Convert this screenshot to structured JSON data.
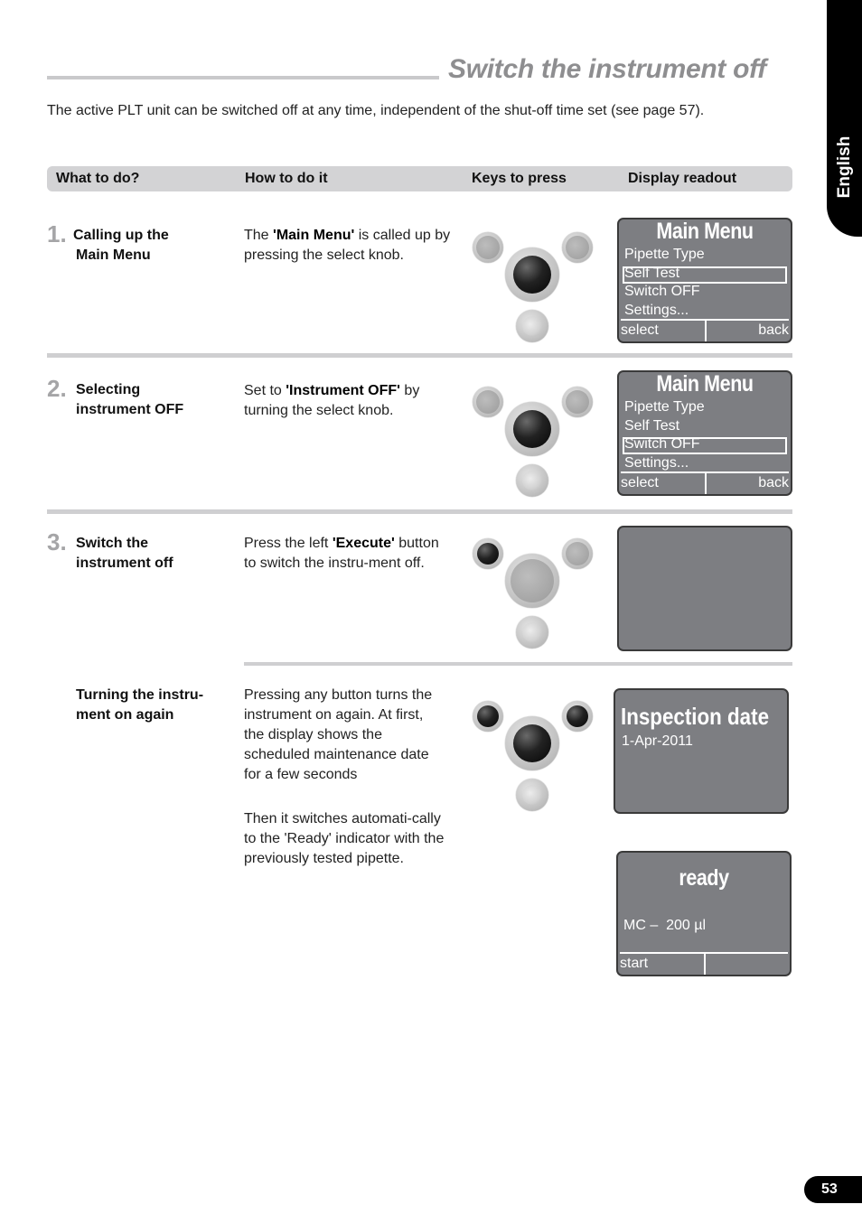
{
  "page": {
    "title": "Switch the instrument off",
    "intro": "The active PLT unit can be switched off at any time, independent of the shut-off time set (see page 57).",
    "language_tab": "English",
    "page_number": "53"
  },
  "table_header": {
    "col1": "What to do?",
    "col2": "How to do it",
    "col3": "Keys to press",
    "col4": "Display readout"
  },
  "steps": [
    {
      "number": "1.",
      "what_line1": "Calling up the",
      "what_line2": "Main Menu",
      "how_pre": "The ",
      "how_bold": "'Main Menu'",
      "how_post": " is called up by pressing the select knob.",
      "keys": {
        "left": "grey",
        "right": "grey",
        "center": "dark",
        "bottom": "light"
      },
      "display": {
        "title": "Main Menu",
        "items": [
          "Pipette Type",
          "Self Test",
          "Switch OFF",
          "Settings..."
        ],
        "selected_index": 1,
        "footer_left": "select",
        "footer_right": "back"
      }
    },
    {
      "number": "2.",
      "what_line1": "Selecting",
      "what_line2": "instrument OFF",
      "how_pre": "Set to ",
      "how_bold": "'Instrument OFF'",
      "how_post": " by turning the select knob.",
      "keys": {
        "left": "grey",
        "right": "grey",
        "center": "dark",
        "bottom": "light"
      },
      "display": {
        "title": "Main Menu",
        "items": [
          "Pipette Type",
          "Self Test",
          "Switch OFF",
          "Settings..."
        ],
        "selected_index": 2,
        "footer_left": "select",
        "footer_right": "back"
      }
    },
    {
      "number": "3.",
      "what_line1": "Switch the",
      "what_line2": "instrument off",
      "how_pre": "Press the left ",
      "how_bold": "'Execute'",
      "how_post": " button to switch the instru-ment off.",
      "keys": {
        "left": "dark",
        "right": "grey",
        "center": "grey",
        "bottom": "light"
      },
      "display": {
        "blank": true
      }
    },
    {
      "number": "",
      "what_line1": "Turning the instru-",
      "what_line2": "ment on again",
      "how_text1": "Pressing any button turns the instrument on again. At first, the display shows the scheduled maintenance date for a few seconds",
      "how_text2": "Then it switches automati-cally to the 'Ready' indicator with the previously tested pipette.",
      "keys": {
        "left": "dark",
        "right": "dark",
        "center": "dark",
        "bottom": "light"
      },
      "display_inspection": {
        "title": "Inspection date",
        "date": "1-Apr-2011"
      },
      "display_ready": {
        "title": "ready",
        "pipette": "MC –  200 µl",
        "footer_left": "start",
        "footer_right": ""
      }
    }
  ]
}
